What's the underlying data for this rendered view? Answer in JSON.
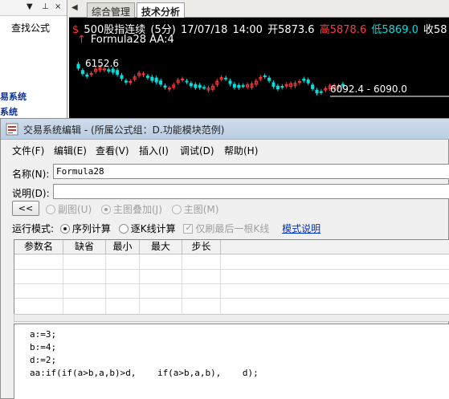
{
  "left_panel": {
    "header_arrow": "▼",
    "header_pin": "⊥",
    "header_close": "×",
    "find_formula": "查找公式",
    "system_items": [
      "易系统",
      "系统"
    ]
  },
  "chart": {
    "tabs": [
      {
        "label": "综合管理",
        "active": false
      },
      {
        "label": "技术分析",
        "active": true
      }
    ],
    "quote": {
      "marker": "$",
      "name": "500股指连续",
      "period": "(5分)",
      "date": "17/07/18",
      "time": "14:00",
      "open": "开5873.6",
      "high": "高5878.6",
      "low": "低5869.0",
      "close": "收58",
      "colors": {
        "up": "#ff3b3b",
        "down": "#00e0e0",
        "text": "#ffffff"
      }
    },
    "formula": {
      "arrow": "↑",
      "name": "Formula28",
      "value": "AA:4"
    },
    "high_label": "6152.6",
    "range_label": "6092.4 - 6090.0"
  },
  "dialog": {
    "title": "交易系统编辑 - (所属公式组：D.功能模块范例)",
    "menu": [
      "文件(F)",
      "编辑(E)",
      "查看(V)",
      "插入(I)",
      "调试(D)",
      "帮助(H)"
    ],
    "name_label": "名称(N):",
    "name_value": "Formula28",
    "desc_label": "说明(D):",
    "desc_value": "",
    "collapse_button": "<<",
    "chart_options": [
      {
        "label": "副图(U)",
        "selected": false
      },
      {
        "label": "主图叠加(J)",
        "selected": true
      },
      {
        "label": "主图(M)",
        "selected": false
      }
    ],
    "run_mode_label": "运行模式:",
    "run_modes": [
      {
        "label": "序列计算",
        "selected": true
      },
      {
        "label": "逐K线计算",
        "selected": false
      }
    ],
    "last_bar_only": "仅刷最后一根K线",
    "mode_help_link": "模式说明",
    "param_headers": [
      "参数名",
      "缺省",
      "最小",
      "最大",
      "步长"
    ],
    "code_lines": [
      "a:=3;",
      "b:=4;",
      "d:=2;",
      "aa:if(if(a>b,a,b)>d,    if(a>b,a,b),    d);"
    ],
    "accent": "#0033cc"
  }
}
